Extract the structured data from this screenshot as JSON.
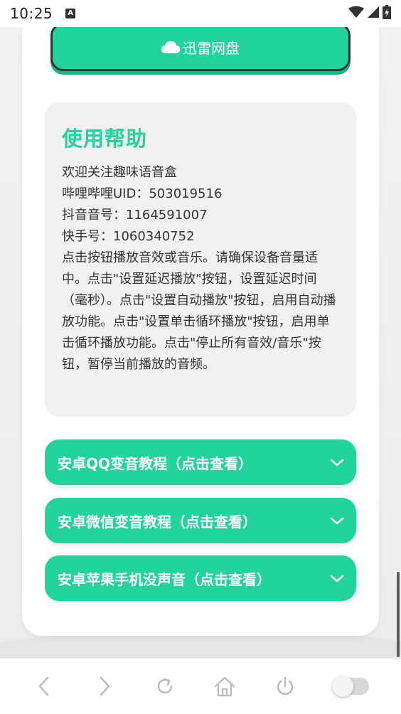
{
  "status_bar": {
    "time": "10:25",
    "notification_icon": "a-icon",
    "wifi_icon": "wifi-icon",
    "signal_icon": "signal-icon",
    "battery_icon": "battery-charging-icon"
  },
  "xunlei_button": {
    "icon": "cloud-icon",
    "label": "迅雷网盘"
  },
  "help": {
    "title": "使用帮助",
    "lines": [
      "欢迎关注趣味语音盒",
      "哔哩哔哩UID：503019516",
      "抖音音号：1164591007",
      "快手号：1060340752"
    ],
    "description": "点击按钮播放音效或音乐。请确保设备音量适中。点击\"设置延迟播放\"按钮，设置延迟时间（毫秒）。点击\"设置自动播放\"按钮，启用自动播放功能。点击\"设置单击循环播放\"按钮，启用单击循环播放功能。点击\"停止所有音效/音乐\"按钮，暂停当前播放的音频。"
  },
  "accordions": [
    {
      "label": "安卓QQ变音教程（点击查看）",
      "icon": "chevron-down-icon"
    },
    {
      "label": "安卓微信变音教程（点击查看）",
      "icon": "chevron-down-icon"
    },
    {
      "label": "安卓苹果手机没声音（点击查看）",
      "icon": "chevron-down-icon"
    }
  ],
  "bottom_nav": {
    "items": [
      "back-icon",
      "forward-icon",
      "refresh-icon",
      "home-icon",
      "power-icon",
      "toggle-switch"
    ]
  },
  "colors": {
    "accent": "#22d49c",
    "background": "#f0f1f0"
  }
}
